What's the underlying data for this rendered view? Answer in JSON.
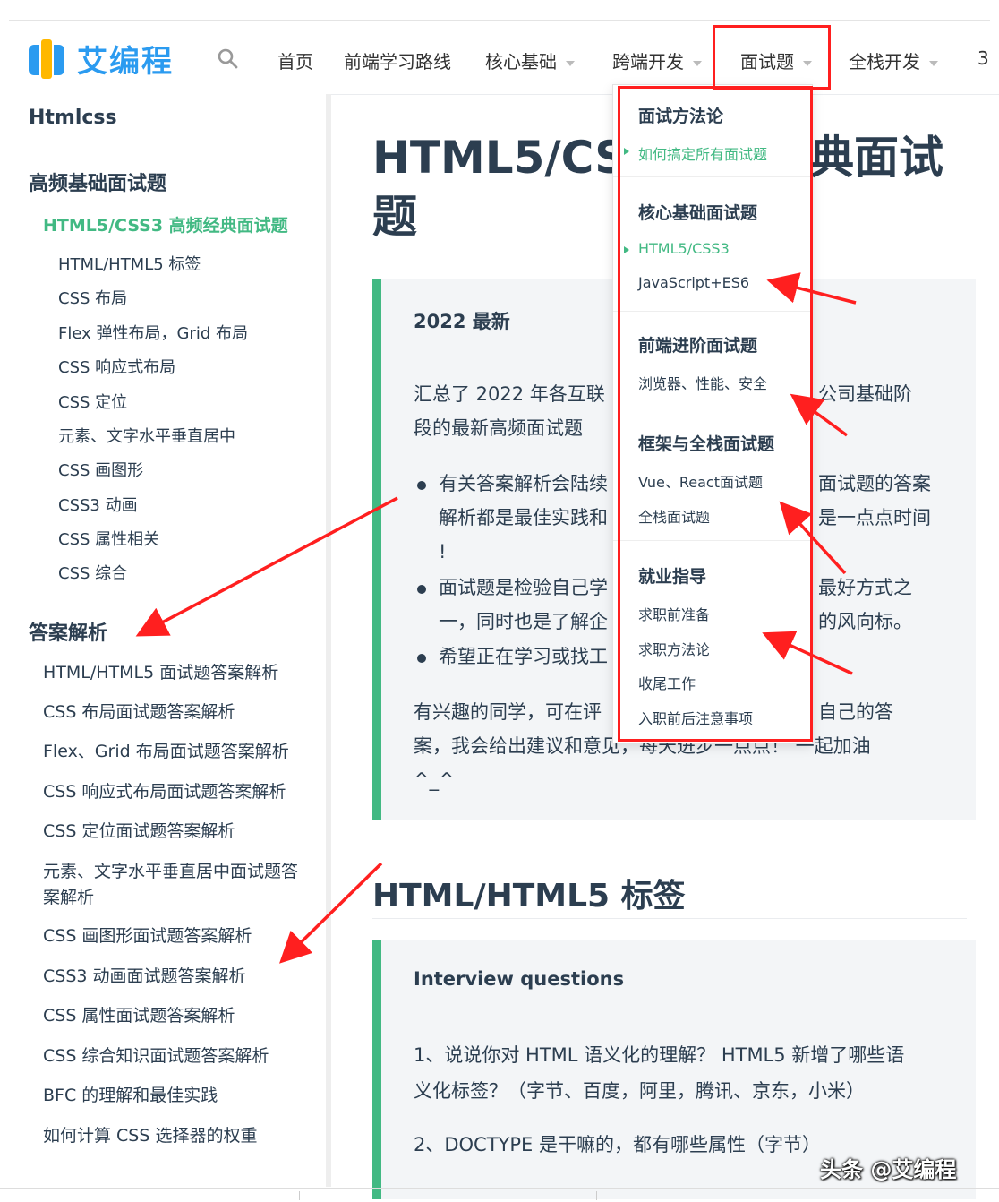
{
  "navbar": {
    "logo_text": "艾编程",
    "items": [
      "首页",
      "前端学习路线",
      "核心基础",
      "跨端开发",
      "面试题",
      "全栈开发",
      "3"
    ]
  },
  "sidebar": {
    "top": "Htmlcss",
    "group1": "高频基础面试题",
    "active": "HTML5/CSS3 高频经典面试题",
    "subs": [
      "HTML/HTML5 标签",
      "CSS 布局",
      "Flex 弹性布局，Grid 布局",
      "CSS 响应式布局",
      "CSS 定位",
      "元素、文字水平垂直居中",
      "CSS 画图形",
      "CSS3 动画",
      "CSS 属性相关",
      "CSS 综合"
    ],
    "group2": "答案解析",
    "answers": [
      "HTML/HTML5 面试题答案解析",
      "CSS 布局面试题答案解析",
      "Flex、Grid 布局面试题答案解析",
      "CSS 响应式布局面试题答案解析",
      "CSS 定位面试题答案解析",
      "元素、文字水平垂直居中面试题答案解析",
      "CSS 画图形面试题答案解析",
      "CSS3 动画面试题答案解析",
      "CSS 属性面试题答案解析",
      "CSS 综合知识面试题答案解析",
      "BFC 的理解和最佳实践",
      "如何计算 CSS 选择器的权重"
    ]
  },
  "main": {
    "title_line1": "HTML5/CSS",
    "title_tail1": "典面试",
    "title_line2": "题",
    "tip1": {
      "title": "2022 最新",
      "p1_a": "汇总了 2022 年各互联",
      "p1_b": "公司基础阶",
      "p1_c": "段的最新高频面试题",
      "b1_a": "有关答案解析会陆续",
      "b1_b": "面试题的答案",
      "b1_c": "解析都是最佳实践和",
      "b1_d": "是一点点时间",
      "b1_e": "!",
      "b2_a": "面试题是检验自己学",
      "b2_b": "最好方式之",
      "b2_c": "一，同时也是了解企",
      "b2_d": "的风向标。",
      "b3_a": "希望正在学习或找工",
      "p2_a": "有兴趣的同学，可在评",
      "p2_b": "自己的答",
      "p2_c": "案，我会给出建议和意见，每天进步一点点！ 一起加油",
      "p2_d": "^_^"
    },
    "h2": "HTML/HTML5 标签",
    "tip2": {
      "title": "Interview questions",
      "q1_a": "1、说说你对 HTML 语义化的理解？ HTML5 新增了哪些语",
      "q1_b": "义化标签？（字节、百度，阿里，腾讯、京东，小米）",
      "q2": "2、DOCTYPE 是干嘛的，都有哪些属性（字节）"
    }
  },
  "dropdown": {
    "sections": [
      {
        "head": "面试方法论",
        "items": [
          "如何搞定所有面试题"
        ]
      },
      {
        "head": "核心基础面试题",
        "items": [
          "HTML5/CSS3",
          "JavaScript+ES6"
        ]
      },
      {
        "head": "前端进阶面试题",
        "items": [
          "浏览器、性能、安全"
        ]
      },
      {
        "head": "框架与全栈面试题",
        "items": [
          "Vue、React面试题",
          "全栈面试题"
        ]
      },
      {
        "head": "就业指导",
        "items": [
          "求职前准备",
          "求职方法论",
          "收尾工作",
          "入职前后注意事项"
        ]
      }
    ]
  },
  "watermark": "头条 @艾编程",
  "colors": {
    "accent": "#42b983",
    "brand": "#2b9bf0",
    "highlight": "#ff1f1f"
  }
}
